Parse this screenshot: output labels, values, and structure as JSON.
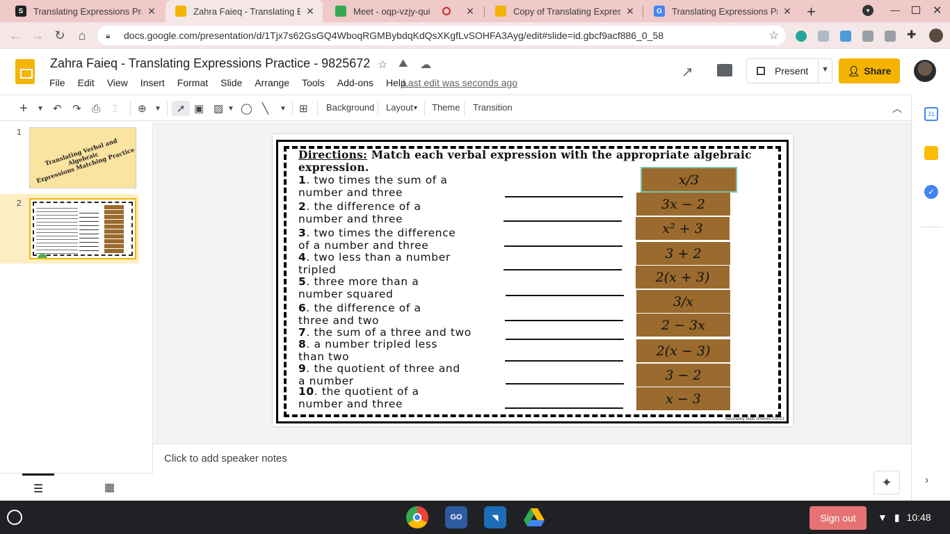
{
  "browser": {
    "tabs": [
      {
        "title": "Translating Expressions Practi",
        "icon_color": "#202124",
        "icon_letter": "S",
        "active": false
      },
      {
        "title": "Zahra Faieq - Translating Expr",
        "icon_color": "#f4b400",
        "icon_letter": "",
        "active": true
      },
      {
        "title": "Meet - oqp-vzjy-qui",
        "icon_color": "#34a853",
        "icon_letter": "",
        "active": false
      },
      {
        "title": "Copy of Translating Expressio",
        "icon_color": "#f4b400",
        "icon_letter": "",
        "active": false
      },
      {
        "title": "Translating Expressions Practi",
        "icon_color": "#4285f4",
        "icon_letter": "G",
        "active": false
      }
    ],
    "url": "docs.google.com/presentation/d/1Tjx7s62GsGQ4WboqRGMBybdqKdQsXKgfLvSOHFA3Ayg/edit#slide=id.gbcf9acf886_0_58",
    "recording_icon": "record-icon"
  },
  "header": {
    "doc_title": "Zahra Faieq - Translating Expressions Practice - 9825672",
    "menu": [
      "File",
      "Edit",
      "View",
      "Insert",
      "Format",
      "Slide",
      "Arrange",
      "Tools",
      "Add-ons",
      "Help"
    ],
    "last_edit": "Last edit was seconds ago",
    "present_label": "Present",
    "share_label": "Share",
    "accent": "#f4b400"
  },
  "toolbar": {
    "background": "Background",
    "layout": "Layout",
    "theme": "Theme",
    "transition": "Transition"
  },
  "filmstrip": {
    "slides": [
      {
        "number": "1",
        "title_line1": "Translating Verbal and Algebraic",
        "title_line2": "Expressions Matching Practice"
      },
      {
        "number": "2"
      }
    ]
  },
  "slide": {
    "directions_label": "Directions:",
    "directions_text": " Match each verbal expression with the appropriate algebraic expression.",
    "items": [
      {
        "num": "1",
        "line1": ". two times the sum of a",
        "line2": "number and three"
      },
      {
        "num": "2",
        "line1": ". the difference of a",
        "line2": "number and three"
      },
      {
        "num": "3",
        "line1": ". two times the difference",
        "line2": "of a number and three"
      },
      {
        "num": "4",
        "line1": ". two less than a number",
        "line2": "tripled"
      },
      {
        "num": "5",
        "line1": ". three more than a",
        "line2": "number squared"
      },
      {
        "num": "6",
        "line1": ". the difference of a",
        "line2": "three and two"
      },
      {
        "num": "7",
        "line1": ". the sum of a three and two",
        "line2": ""
      },
      {
        "num": "8",
        "line1": ". a number tripled less",
        "line2": "than two"
      },
      {
        "num": "9",
        "line1": ". the quotient of three and",
        "line2": "a number"
      },
      {
        "num": "10",
        "line1": ". the quotient of a",
        "line2": "number and three"
      }
    ],
    "cards": [
      "x/3",
      "3x − 2",
      "x² + 3",
      "3 + 2",
      "2(x + 3)",
      "3/x",
      "2 − 3x",
      "2(x − 3)",
      "3 − 2",
      "x − 3"
    ],
    "card_color": "#9a6a2e",
    "copyright": "Secondary Math Shelves ©2021"
  },
  "notes": {
    "placeholder": "Click to add speaker notes"
  },
  "shelf": {
    "signout_label": "Sign out",
    "time": "10:48",
    "apps": [
      "chrome-icon",
      "lcps-go-icon",
      "classroom-icon",
      "drive-icon"
    ]
  }
}
